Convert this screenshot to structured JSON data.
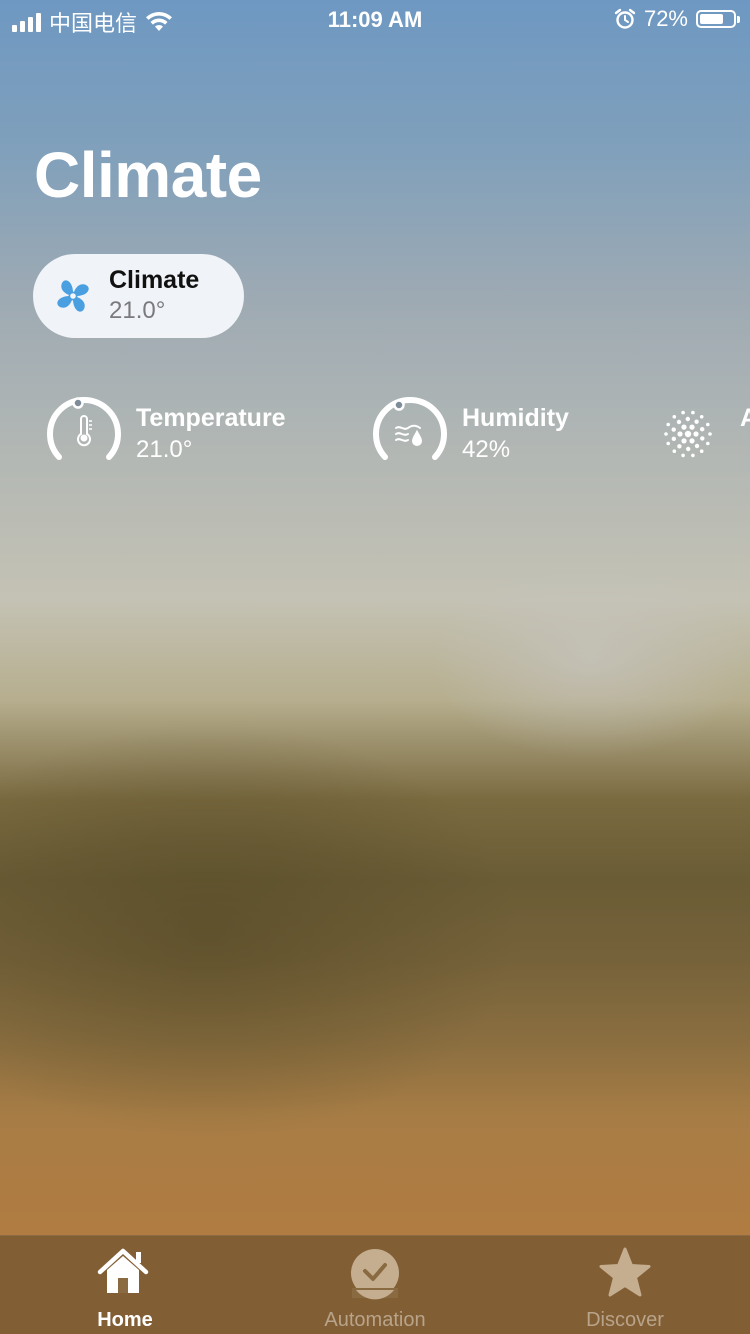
{
  "status_bar": {
    "carrier": "中国电信",
    "time": "11:09 AM",
    "battery_percent_text": "72%",
    "battery_level": 0.72
  },
  "page": {
    "title": "Climate"
  },
  "climate_tile": {
    "name": "Climate",
    "value": "21.0°",
    "icon": "fan-icon"
  },
  "sensors": [
    {
      "label": "Temperature",
      "value": "21.0°",
      "icon": "thermometer-icon"
    },
    {
      "label": "Humidity",
      "value": "42%",
      "icon": "humidity-icon"
    },
    {
      "label": "A",
      "icon": "air-quality-icon"
    }
  ],
  "tab_bar": {
    "tabs": [
      {
        "label": "Home",
        "icon": "home-icon",
        "active": true
      },
      {
        "label": "Automation",
        "icon": "clock-icon",
        "active": false
      },
      {
        "label": "Discover",
        "icon": "star-icon",
        "active": false
      }
    ],
    "active_color": "#ffffff",
    "inactive_color": "#b8a48a"
  },
  "colors": {
    "fan_blue": "#4a9fe0",
    "tile_bg": "#f4f6fa"
  }
}
